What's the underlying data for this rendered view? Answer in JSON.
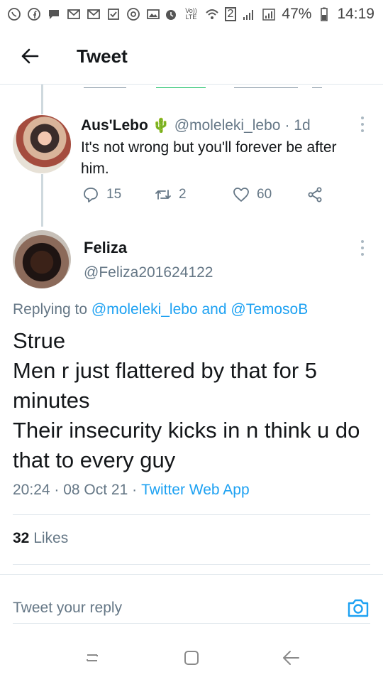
{
  "status_bar": {
    "volte": "Vo)) LTE",
    "sim": "2",
    "battery": "47%",
    "time": "14:19"
  },
  "header": {
    "title": "Tweet"
  },
  "reply_tweet": {
    "name": "Aus'Lebo",
    "emoji": "🌵",
    "handle": "@moleleki_lebo",
    "time": "· 1d",
    "text": "It's not wrong but you'll forever be after him.",
    "replies": "15",
    "retweets": "2",
    "likes": "60"
  },
  "main_tweet": {
    "name": "Feliza",
    "handle": "@Feliza201624122",
    "replying_prefix": "Replying to",
    "mention_1": "@moleleki_lebo",
    "and": "and",
    "mention_2": "@TemosoB",
    "lines": [
      "Strue",
      "Men r just flattered by that for 5 minutes",
      "Their insecurity kicks in n think u do that to every guy"
    ],
    "time": "20:24 · 08 Oct 21 ·",
    "source": "Twitter Web App",
    "likes_count": "32",
    "likes_label": "Likes"
  },
  "composer": {
    "placeholder": "Tweet your reply"
  },
  "colors": {
    "accent": "#1da1f2",
    "secondary_text": "#657786",
    "divider": "#e1e8ed"
  }
}
